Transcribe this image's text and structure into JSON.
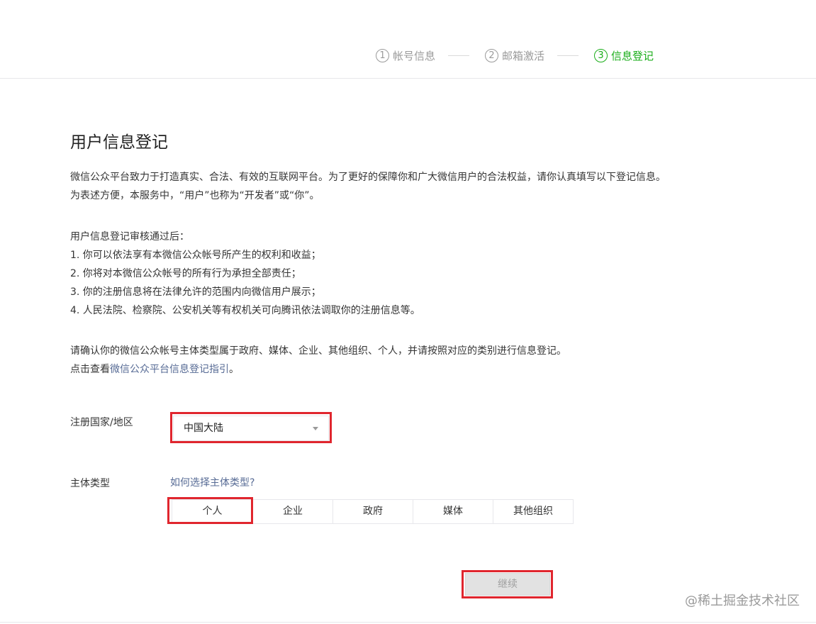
{
  "steps": [
    {
      "num": "1",
      "label": "帐号信息"
    },
    {
      "num": "2",
      "label": "邮箱激活"
    },
    {
      "num": "3",
      "label": "信息登记"
    }
  ],
  "title": "用户信息登记",
  "intro": {
    "line1": "微信公众平台致力于打造真实、合法、有效的互联网平台。为了更好的保障你和广大微信用户的合法权益，请你认真填写以下登记信息。",
    "line2": "为表述方便，本服务中，“用户”也称为“开发者”或“你”。"
  },
  "benefits": {
    "heading": "用户信息登记审核通过后：",
    "items": [
      "1. 你可以依法享有本微信公众帐号所产生的权利和收益；",
      "2. 你将对本微信公众帐号的所有行为承担全部责任；",
      "3. 你的注册信息将在法律允许的范围内向微信用户展示；",
      "4. 人民法院、检察院、公安机关等有权机关可向腾讯依法调取你的注册信息等。"
    ]
  },
  "confirm": {
    "line1": "请确认你的微信公众帐号主体类型属于政府、媒体、企业、其他组织、个人，并请按照对应的类别进行信息登记。",
    "line2_prefix": "点击查看",
    "line2_link": "微信公众平台信息登记指引",
    "line2_suffix": "。"
  },
  "region": {
    "label": "注册国家/地区",
    "value": "中国大陆"
  },
  "entity": {
    "label": "主体类型",
    "help_link": "如何选择主体类型?",
    "options": [
      "个人",
      "企业",
      "政府",
      "媒体",
      "其他组织"
    ]
  },
  "continue_label": "继续",
  "watermark": "@稀土掘金技术社区",
  "colors": {
    "active_step": "#1aad19",
    "link": "#576b95",
    "highlight": "#e0262e"
  }
}
